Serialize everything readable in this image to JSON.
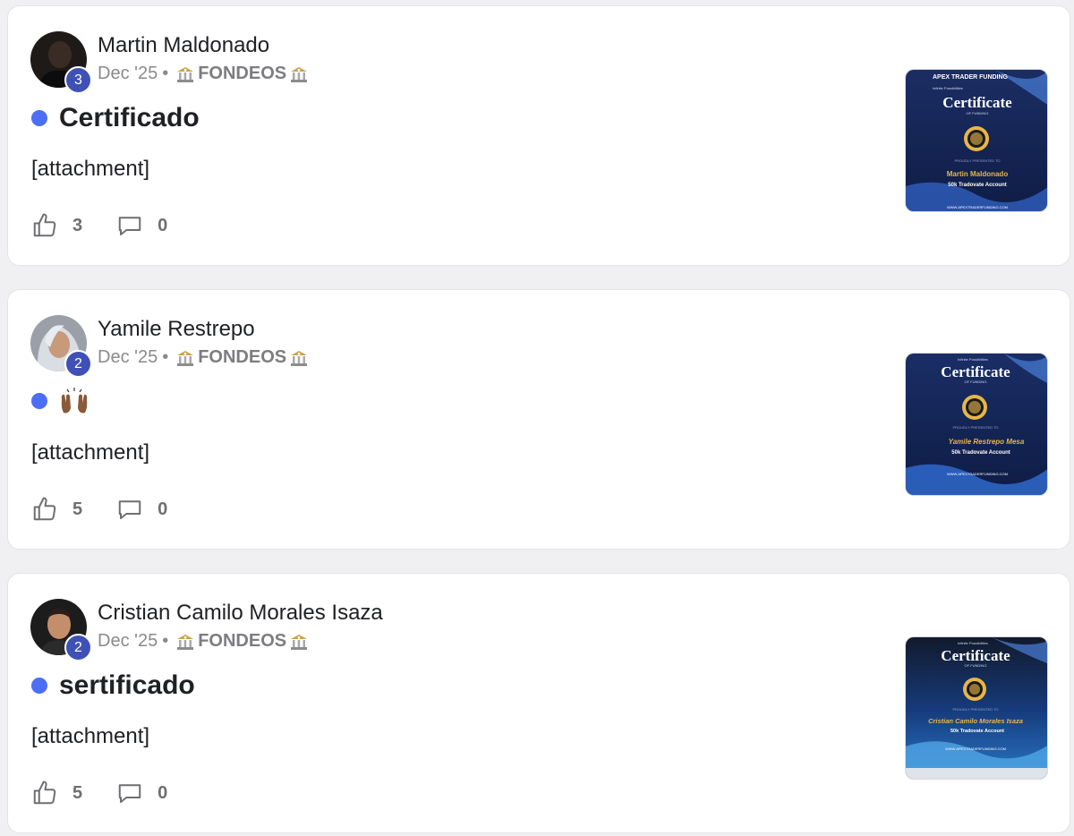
{
  "posts": [
    {
      "author": "Martin Maldonado",
      "level": "3",
      "date": "Dec '25",
      "separator": "•",
      "category": "FONDEOS",
      "title": "Certificado",
      "body": "[attachment]",
      "likes": "3",
      "comments": "0",
      "certificate": {
        "brand": "APEX TRADER FUNDING",
        "tagline": "Infinite Possibilities",
        "heading": "Certificate",
        "subheading": "OF FUNDING",
        "presented": "PROUDLY PRESENTED TO",
        "recipient": "Martin Maldonado",
        "account": "50k Tradovate Account",
        "website": "WWW.APEXTRADERFUNDING.COM"
      }
    },
    {
      "author": "Yamile Restrepo",
      "level": "2",
      "date": "Dec '25",
      "separator": "•",
      "category": "FONDEOS",
      "title_icon": "raised-hands-icon",
      "body": "[attachment]",
      "likes": "5",
      "comments": "0",
      "certificate": {
        "tagline": "Infinite Possibilities",
        "heading": "Certificate",
        "subheading": "OF FUNDING",
        "presented": "PROUDLY PRESENTED TO",
        "recipient": "Yamile Restrepo Mesa",
        "account": "50k Tradovate Account",
        "website": "WWW.APEXTRADERFUNDING.COM"
      }
    },
    {
      "author": "Cristian Camilo Morales Isaza",
      "level": "2",
      "date": "Dec '25",
      "separator": "•",
      "category": "FONDEOS",
      "title": "sertificado",
      "body": "[attachment]",
      "likes": "5",
      "comments": "0",
      "certificate": {
        "tagline": "Infinite Possibilities",
        "heading": "Certificate",
        "subheading": "OF FUNDING",
        "presented": "PROUDLY PRESENTED TO",
        "recipient": "Cristian Camilo Morales Isaza",
        "account": "50k Tradovate Account",
        "website": "WWW.APEXTRADERFUNDING.COM"
      }
    }
  ],
  "colors": {
    "unread_dot": "#4c6ef5",
    "level_badge": "#3f51b5",
    "certificate_bg": "#13254f",
    "certificate_gold": "#e6b64a"
  },
  "icons": [
    "bank-icon",
    "thumbs-up-icon",
    "comment-icon",
    "raised-hands-icon",
    "award-seal-icon"
  ]
}
